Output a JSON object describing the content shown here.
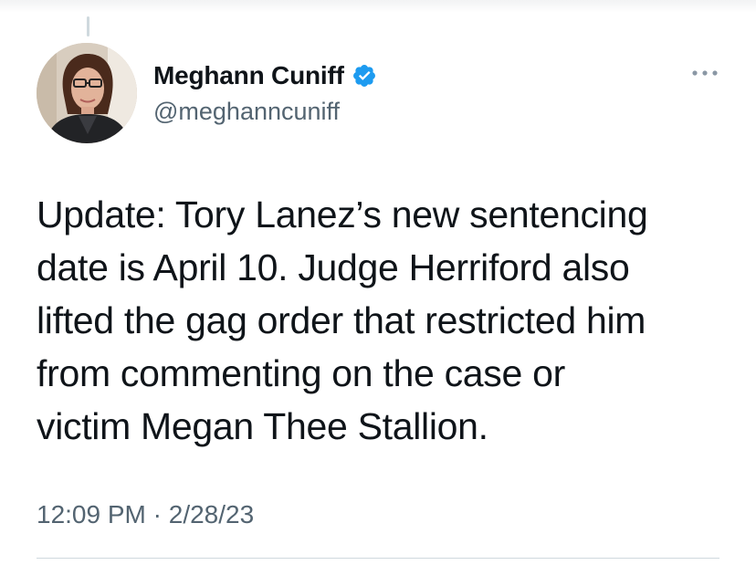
{
  "tweet": {
    "author": {
      "display_name": "Meghann Cuniff",
      "handle": "@meghanncuniff",
      "verified": true
    },
    "text": "Update: Tory Lanez’s new sentencing\ndate is April 10. Judge Herriford also\nlifted the gag order that restricted him\nfrom commenting on the case or\nvictim Megan Thee Stallion.",
    "time": "12:09 PM",
    "separator": " · ",
    "date": "2/28/23"
  },
  "icons": {
    "verified": "verified-badge-icon",
    "more": "more-options-icon"
  },
  "colors": {
    "text": "#0f1419",
    "secondary_text": "#536471",
    "verified_blue": "#1d9bf0",
    "divider": "#cfd9de"
  }
}
